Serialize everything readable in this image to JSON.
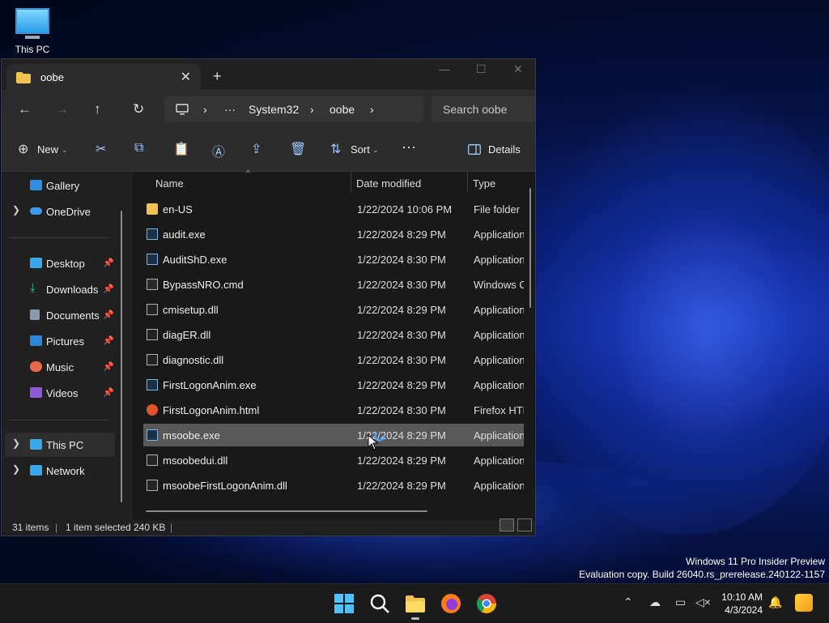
{
  "desktop": {
    "this_pc_label": "This PC"
  },
  "watermark": {
    "line1": "Windows 11 Pro Insider Preview",
    "line2": "Evaluation copy. Build 26040.rs_prerelease.240122-1157"
  },
  "window": {
    "tab_title": "oobe",
    "breadcrumb": {
      "ellipsis": "···",
      "system32": "System32",
      "oobe": "oobe"
    },
    "search_placeholder": "Search oobe",
    "toolbar": {
      "new_label": "New",
      "sort_label": "Sort",
      "details_label": "Details"
    },
    "sidebar": {
      "gallery": "Gallery",
      "onedrive": "OneDrive",
      "desktop": "Desktop",
      "downloads": "Downloads",
      "documents": "Documents",
      "pictures": "Pictures",
      "music": "Music",
      "videos": "Videos",
      "this_pc": "This PC",
      "network": "Network"
    },
    "columns": {
      "name": "Name",
      "date": "Date modified",
      "type": "Type"
    },
    "files": [
      {
        "name": "en-US",
        "date": "1/22/2024 10:06 PM",
        "type": "File folder"
      },
      {
        "name": "audit.exe",
        "date": "1/22/2024 8:29 PM",
        "type": "Application"
      },
      {
        "name": "AuditShD.exe",
        "date": "1/22/2024 8:30 PM",
        "type": "Application"
      },
      {
        "name": "BypassNRO.cmd",
        "date": "1/22/2024 8:30 PM",
        "type": "Windows Co"
      },
      {
        "name": "cmisetup.dll",
        "date": "1/22/2024 8:29 PM",
        "type": "Application"
      },
      {
        "name": "diagER.dll",
        "date": "1/22/2024 8:30 PM",
        "type": "Application"
      },
      {
        "name": "diagnostic.dll",
        "date": "1/22/2024 8:30 PM",
        "type": "Application"
      },
      {
        "name": "FirstLogonAnim.exe",
        "date": "1/22/2024 8:29 PM",
        "type": "Application"
      },
      {
        "name": "FirstLogonAnim.html",
        "date": "1/22/2024 8:30 PM",
        "type": "Firefox HTM"
      },
      {
        "name": "msoobe.exe",
        "date": "1/22/2024 8:29 PM",
        "type": "Application"
      },
      {
        "name": "msoobedui.dll",
        "date": "1/22/2024 8:29 PM",
        "type": "Application"
      },
      {
        "name": "msoobeFirstLogonAnim.dll",
        "date": "1/22/2024 8:29 PM",
        "type": "Application"
      }
    ],
    "status": {
      "items": "31 items",
      "selected": "1 item selected",
      "size": "240 KB"
    }
  },
  "taskbar": {
    "time": "10:10 AM",
    "date": "4/3/2024"
  }
}
